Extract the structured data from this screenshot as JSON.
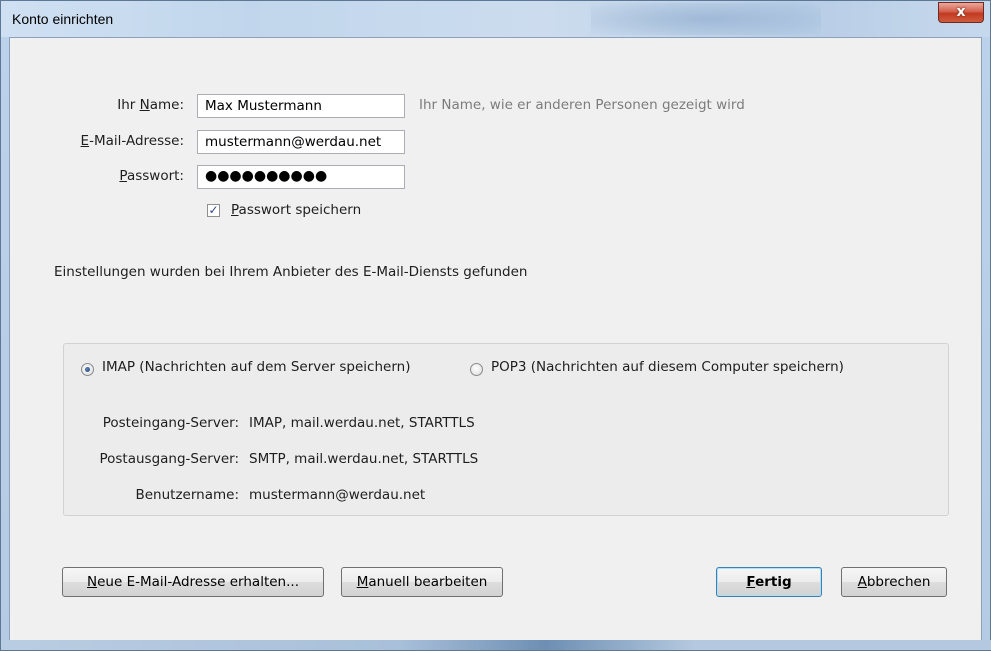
{
  "window": {
    "title": "Konto einrichten",
    "close_glyph": "x"
  },
  "form": {
    "name_label_pre": "Ihr ",
    "name_label_key": "N",
    "name_label_post": "ame:",
    "name_value": "Max Mustermann",
    "name_hint": "Ihr Name, wie er anderen Personen gezeigt wird",
    "email_label_key": "E",
    "email_label_post": "-Mail-Adresse:",
    "email_value": "mustermann@werdau.net",
    "password_label_key": "P",
    "password_label_post": "asswort:",
    "password_value": "●●●●●●●●●●",
    "save_password_key": "P",
    "save_password_post": "asswort speichern",
    "save_password_checked": true,
    "checkmark": "✓"
  },
  "status_text": "Einstellungen wurden bei Ihrem Anbieter des E-Mail-Diensts gefunden",
  "protocol": {
    "imap_label": "IMAP (Nachrichten auf dem Server speichern)",
    "pop3_label": "POP3 (Nachrichten auf diesem Computer speichern)",
    "selected": "IMAP"
  },
  "server_info": {
    "incoming_label": "Posteingang-Server:",
    "incoming_value": "IMAP, mail.werdau.net, STARTTLS",
    "outgoing_label": "Postausgang-Server:",
    "outgoing_value": "SMTP, mail.werdau.net, STARTTLS",
    "username_label": "Benutzername:",
    "username_value": "mustermann@werdau.net"
  },
  "buttons": {
    "new_address_key": "N",
    "new_address_post": "eue E-Mail-Adresse erhalten...",
    "manual_key": "M",
    "manual_post": "anuell bearbeiten",
    "done_key": "F",
    "done_post": "ertig",
    "cancel_key": "A",
    "cancel_post": "bbrechen"
  },
  "colors": {
    "dialog_bg": "#f0f0f0",
    "close_button": "#c23a22",
    "hint_text": "#7c7c7c",
    "default_button_border": "#3c7fb1"
  }
}
